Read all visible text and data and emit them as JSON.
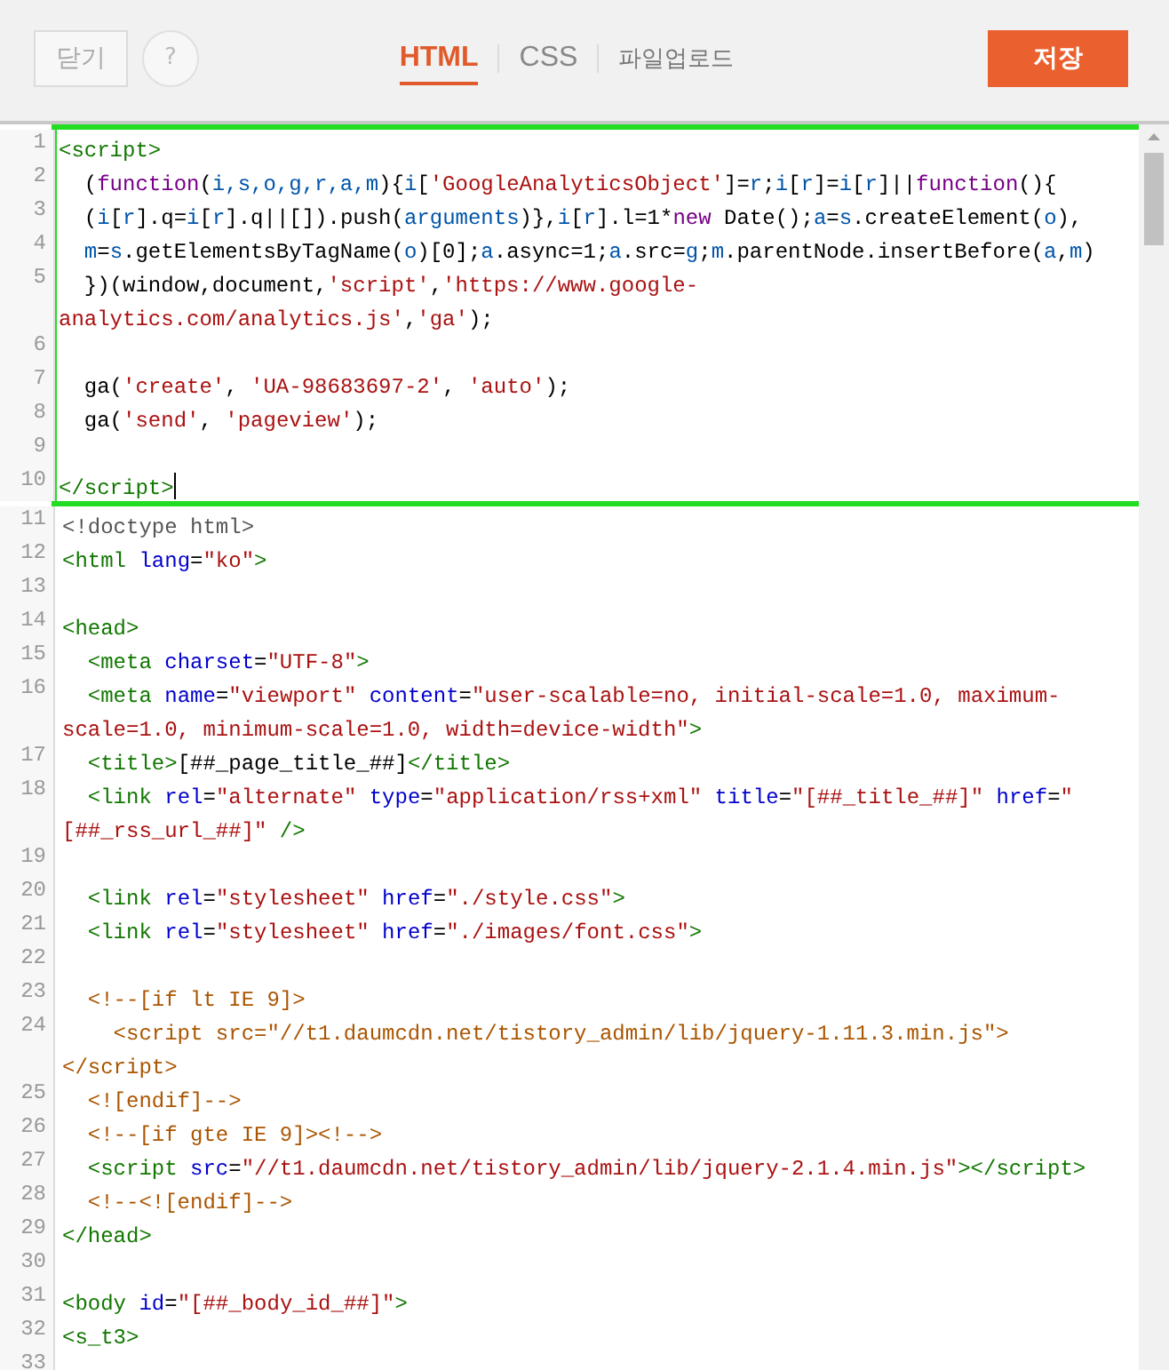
{
  "toolbar": {
    "close_button": "닫기",
    "help_button": "?",
    "save_button": "저장"
  },
  "tabs": [
    {
      "label": "HTML",
      "selected": true
    },
    {
      "label": "CSS",
      "selected": false
    },
    {
      "label": "파일업로드",
      "selected": false
    }
  ],
  "editor": {
    "highlighted_lines": [
      {
        "number": "1",
        "cursor": false,
        "rows": [
          {
            "tokens": [
              {
                "kind": "tag",
                "text": "<script>"
              }
            ]
          }
        ]
      },
      {
        "number": "2",
        "cursor": false,
        "rows": [
          {
            "tokens": [
              {
                "kind": "plain",
                "text": "  ("
              },
              {
                "kind": "keyword",
                "text": "function"
              },
              {
                "kind": "plain",
                "text": "("
              },
              {
                "kind": "variable",
                "text": "i,s,o,g,r,a,m"
              },
              {
                "kind": "plain",
                "text": "){"
              },
              {
                "kind": "variable",
                "text": "i"
              },
              {
                "kind": "plain",
                "text": "["
              },
              {
                "kind": "string",
                "text": "'GoogleAnalyticsObject'"
              },
              {
                "kind": "plain",
                "text": "]="
              },
              {
                "kind": "variable",
                "text": "r"
              },
              {
                "kind": "plain",
                "text": ";"
              },
              {
                "kind": "variable",
                "text": "i"
              },
              {
                "kind": "plain",
                "text": "["
              },
              {
                "kind": "variable",
                "text": "r"
              },
              {
                "kind": "plain",
                "text": "]="
              },
              {
                "kind": "variable",
                "text": "i"
              },
              {
                "kind": "plain",
                "text": "["
              },
              {
                "kind": "variable",
                "text": "r"
              },
              {
                "kind": "plain",
                "text": "]||"
              },
              {
                "kind": "keyword",
                "text": "function"
              },
              {
                "kind": "plain",
                "text": "(){"
              }
            ]
          }
        ]
      },
      {
        "number": "3",
        "cursor": false,
        "rows": [
          {
            "tokens": [
              {
                "kind": "plain",
                "text": "  ("
              },
              {
                "kind": "variable",
                "text": "i"
              },
              {
                "kind": "plain",
                "text": "["
              },
              {
                "kind": "variable",
                "text": "r"
              },
              {
                "kind": "plain",
                "text": "].q="
              },
              {
                "kind": "variable",
                "text": "i"
              },
              {
                "kind": "plain",
                "text": "["
              },
              {
                "kind": "variable",
                "text": "r"
              },
              {
                "kind": "plain",
                "text": "].q||[]).push("
              },
              {
                "kind": "variable",
                "text": "arguments"
              },
              {
                "kind": "plain",
                "text": ")},"
              },
              {
                "kind": "variable",
                "text": "i"
              },
              {
                "kind": "plain",
                "text": "["
              },
              {
                "kind": "variable",
                "text": "r"
              },
              {
                "kind": "plain",
                "text": "].l=1*"
              },
              {
                "kind": "keyword",
                "text": "new"
              },
              {
                "kind": "plain",
                "text": " Date();"
              },
              {
                "kind": "variable",
                "text": "a"
              },
              {
                "kind": "plain",
                "text": "="
              },
              {
                "kind": "variable",
                "text": "s"
              },
              {
                "kind": "plain",
                "text": ".createElement("
              },
              {
                "kind": "variable",
                "text": "o"
              },
              {
                "kind": "plain",
                "text": "),"
              }
            ]
          }
        ]
      },
      {
        "number": "4",
        "cursor": false,
        "rows": [
          {
            "tokens": [
              {
                "kind": "variable",
                "text": "  m"
              },
              {
                "kind": "plain",
                "text": "="
              },
              {
                "kind": "variable",
                "text": "s"
              },
              {
                "kind": "plain",
                "text": ".getElementsByTagName("
              },
              {
                "kind": "variable",
                "text": "o"
              },
              {
                "kind": "plain",
                "text": ")[0];"
              },
              {
                "kind": "variable",
                "text": "a"
              },
              {
                "kind": "plain",
                "text": ".async=1;"
              },
              {
                "kind": "variable",
                "text": "a"
              },
              {
                "kind": "plain",
                "text": ".src="
              },
              {
                "kind": "variable",
                "text": "g"
              },
              {
                "kind": "plain",
                "text": ";"
              },
              {
                "kind": "variable",
                "text": "m"
              },
              {
                "kind": "plain",
                "text": ".parentNode.insertBefore("
              },
              {
                "kind": "variable",
                "text": "a"
              },
              {
                "kind": "plain",
                "text": ","
              },
              {
                "kind": "variable",
                "text": "m"
              },
              {
                "kind": "plain",
                "text": ")"
              }
            ]
          }
        ]
      },
      {
        "number": "5",
        "cursor": false,
        "rows": [
          {
            "tokens": [
              {
                "kind": "plain",
                "text": "  })(window,document,"
              },
              {
                "kind": "string",
                "text": "'script'"
              },
              {
                "kind": "plain",
                "text": ","
              },
              {
                "kind": "string",
                "text": "'https://www.google-"
              }
            ]
          },
          {
            "tokens": [
              {
                "kind": "string",
                "text": "analytics.com/analytics.js'"
              },
              {
                "kind": "plain",
                "text": ","
              },
              {
                "kind": "string",
                "text": "'ga'"
              },
              {
                "kind": "plain",
                "text": ");"
              }
            ]
          }
        ]
      },
      {
        "number": "6",
        "cursor": false
      },
      {
        "number": "7",
        "cursor": false,
        "rows": [
          {
            "tokens": [
              {
                "kind": "plain",
                "text": "  ga("
              },
              {
                "kind": "string",
                "text": "'create'"
              },
              {
                "kind": "plain",
                "text": ", "
              },
              {
                "kind": "string",
                "text": "'UA-98683697-2'"
              },
              {
                "kind": "plain",
                "text": ", "
              },
              {
                "kind": "string",
                "text": "'auto'"
              },
              {
                "kind": "plain",
                "text": ");"
              }
            ]
          }
        ]
      },
      {
        "number": "8",
        "cursor": false,
        "rows": [
          {
            "tokens": [
              {
                "kind": "plain",
                "text": "  ga("
              },
              {
                "kind": "string",
                "text": "'send'"
              },
              {
                "kind": "plain",
                "text": ", "
              },
              {
                "kind": "string",
                "text": "'pageview'"
              },
              {
                "kind": "plain",
                "text": ");"
              }
            ]
          }
        ]
      },
      {
        "number": "9",
        "cursor": false
      },
      {
        "number": "10",
        "cursor": true,
        "rows": [
          {
            "tokens": [
              {
                "kind": "tag",
                "text": "</script>"
              }
            ]
          }
        ]
      }
    ],
    "lines": [
      {
        "number": "11",
        "cursor": false,
        "rows": [
          {
            "tokens": [
              {
                "kind": "meta",
                "text": "<!doctype html>"
              }
            ]
          }
        ]
      },
      {
        "number": "12",
        "cursor": false,
        "rows": [
          {
            "tokens": [
              {
                "kind": "tag",
                "text": "<html"
              },
              {
                "kind": "attribute",
                "text": " lang"
              },
              {
                "kind": "plain",
                "text": "="
              },
              {
                "kind": "string",
                "text": "\"ko\""
              },
              {
                "kind": "tag",
                "text": ">"
              }
            ]
          }
        ]
      },
      {
        "number": "13",
        "cursor": false
      },
      {
        "number": "14",
        "cursor": false,
        "rows": [
          {
            "tokens": [
              {
                "kind": "tag",
                "text": "<head>"
              }
            ]
          }
        ]
      },
      {
        "number": "15",
        "cursor": false,
        "rows": [
          {
            "tokens": [
              {
                "kind": "tag",
                "text": "  <meta"
              },
              {
                "kind": "attribute",
                "text": " charset"
              },
              {
                "kind": "plain",
                "text": "="
              },
              {
                "kind": "string",
                "text": "\"UTF-8\""
              },
              {
                "kind": "tag",
                "text": ">"
              }
            ]
          }
        ]
      },
      {
        "number": "16",
        "cursor": false,
        "rows": [
          {
            "tokens": [
              {
                "kind": "tag",
                "text": "  <meta"
              },
              {
                "kind": "attribute",
                "text": " name"
              },
              {
                "kind": "plain",
                "text": "="
              },
              {
                "kind": "string",
                "text": "\"viewport\""
              },
              {
                "kind": "attribute",
                "text": " content"
              },
              {
                "kind": "plain",
                "text": "="
              },
              {
                "kind": "string",
                "text": "\"user-scalable=no, initial-scale=1.0, maximum-"
              }
            ]
          },
          {
            "tokens": [
              {
                "kind": "string",
                "text": "scale=1.0, minimum-scale=1.0, width=device-width\""
              },
              {
                "kind": "tag",
                "text": ">"
              }
            ]
          }
        ]
      },
      {
        "number": "17",
        "cursor": false,
        "rows": [
          {
            "tokens": [
              {
                "kind": "tag",
                "text": "  <title>"
              },
              {
                "kind": "plain",
                "text": "[##_page_title_##]"
              },
              {
                "kind": "tag",
                "text": "</title>"
              }
            ]
          }
        ]
      },
      {
        "number": "18",
        "cursor": false,
        "rows": [
          {
            "tokens": [
              {
                "kind": "tag",
                "text": "  <link"
              },
              {
                "kind": "attribute",
                "text": " rel"
              },
              {
                "kind": "plain",
                "text": "="
              },
              {
                "kind": "string",
                "text": "\"alternate\""
              },
              {
                "kind": "attribute",
                "text": " type"
              },
              {
                "kind": "plain",
                "text": "="
              },
              {
                "kind": "string",
                "text": "\"application/rss+xml\""
              },
              {
                "kind": "attribute",
                "text": " title"
              },
              {
                "kind": "plain",
                "text": "="
              },
              {
                "kind": "string",
                "text": "\"[##_title_##]\""
              },
              {
                "kind": "attribute",
                "text": " href"
              },
              {
                "kind": "plain",
                "text": "="
              },
              {
                "kind": "string",
                "text": "\""
              }
            ]
          },
          {
            "tokens": [
              {
                "kind": "string",
                "text": "[##_rss_url_##]\""
              },
              {
                "kind": "tag",
                "text": " />"
              }
            ]
          }
        ]
      },
      {
        "number": "19",
        "cursor": false
      },
      {
        "number": "20",
        "cursor": false,
        "rows": [
          {
            "tokens": [
              {
                "kind": "tag",
                "text": "  <link"
              },
              {
                "kind": "attribute",
                "text": " rel"
              },
              {
                "kind": "plain",
                "text": "="
              },
              {
                "kind": "string",
                "text": "\"stylesheet\""
              },
              {
                "kind": "attribute",
                "text": " href"
              },
              {
                "kind": "plain",
                "text": "="
              },
              {
                "kind": "string",
                "text": "\"./style.css\""
              },
              {
                "kind": "tag",
                "text": ">"
              }
            ]
          }
        ]
      },
      {
        "number": "21",
        "cursor": false,
        "rows": [
          {
            "tokens": [
              {
                "kind": "tag",
                "text": "  <link"
              },
              {
                "kind": "attribute",
                "text": " rel"
              },
              {
                "kind": "plain",
                "text": "="
              },
              {
                "kind": "string",
                "text": "\"stylesheet\""
              },
              {
                "kind": "attribute",
                "text": " href"
              },
              {
                "kind": "plain",
                "text": "="
              },
              {
                "kind": "string",
                "text": "\"./images/font.css\""
              },
              {
                "kind": "tag",
                "text": ">"
              }
            ]
          }
        ]
      },
      {
        "number": "22",
        "cursor": false
      },
      {
        "number": "23",
        "cursor": false,
        "rows": [
          {
            "tokens": [
              {
                "kind": "comment",
                "text": "  <!--[if lt IE 9]>"
              }
            ]
          }
        ]
      },
      {
        "number": "24",
        "cursor": false,
        "rows": [
          {
            "tokens": [
              {
                "kind": "comment",
                "text": "    <script src=\"//t1.daumcdn.net/tistory_admin/lib/jquery-1.11.3.min.js\">"
              }
            ]
          },
          {
            "tokens": [
              {
                "kind": "comment",
                "text": "</script>"
              }
            ]
          }
        ]
      },
      {
        "number": "25",
        "cursor": false,
        "rows": [
          {
            "tokens": [
              {
                "kind": "comment",
                "text": "  <![endif]-->"
              }
            ]
          }
        ]
      },
      {
        "number": "26",
        "cursor": false,
        "rows": [
          {
            "tokens": [
              {
                "kind": "comment",
                "text": "  <!--[if gte IE 9]><!-->"
              }
            ]
          }
        ]
      },
      {
        "number": "27",
        "cursor": false,
        "rows": [
          {
            "tokens": [
              {
                "kind": "tag",
                "text": "  <script"
              },
              {
                "kind": "attribute",
                "text": " src"
              },
              {
                "kind": "plain",
                "text": "="
              },
              {
                "kind": "string",
                "text": "\"//t1.daumcdn.net/tistory_admin/lib/jquery-2.1.4.min.js\""
              },
              {
                "kind": "tag",
                "text": "></script>"
              }
            ]
          }
        ]
      },
      {
        "number": "28",
        "cursor": false,
        "rows": [
          {
            "tokens": [
              {
                "kind": "comment",
                "text": "  <!--<![endif]-->"
              }
            ]
          }
        ]
      },
      {
        "number": "29",
        "cursor": false,
        "rows": [
          {
            "tokens": [
              {
                "kind": "tag",
                "text": "</head>"
              }
            ]
          }
        ]
      },
      {
        "number": "30",
        "cursor": false
      },
      {
        "number": "31",
        "cursor": false,
        "rows": [
          {
            "tokens": [
              {
                "kind": "tag",
                "text": "<body"
              },
              {
                "kind": "attribute",
                "text": " id"
              },
              {
                "kind": "plain",
                "text": "="
              },
              {
                "kind": "string",
                "text": "\"[##_body_id_##]\""
              },
              {
                "kind": "tag",
                "text": ">"
              }
            ]
          }
        ]
      },
      {
        "number": "32",
        "cursor": false,
        "rows": [
          {
            "tokens": [
              {
                "kind": "tag",
                "text": "<s_t3>"
              }
            ]
          }
        ]
      },
      {
        "number": "33",
        "cursor": false
      }
    ]
  }
}
